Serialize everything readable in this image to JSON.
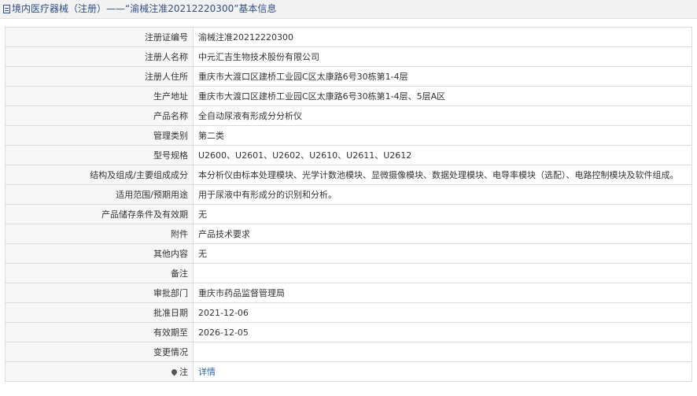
{
  "header": {
    "category": "境内医疗器械（注册）",
    "separator": "——",
    "title": "“渝械注准20212220300”基本信息"
  },
  "rows": [
    {
      "label": "注册证编号",
      "value": "渝械注准20212220300"
    },
    {
      "label": "注册人名称",
      "value": "中元汇吉生物技术股份有限公司"
    },
    {
      "label": "注册人住所",
      "value": "重庆市大渡口区建桥工业园C区太康路6号30栋第1-4层"
    },
    {
      "label": "生产地址",
      "value": "重庆市大渡口区建桥工业园C区太康路6号30栋第1-4层、5层A区"
    },
    {
      "label": "产品名称",
      "value": "全自动尿液有形成分分析仪"
    },
    {
      "label": "管理类别",
      "value": "第二类"
    },
    {
      "label": "型号规格",
      "value": "U2600、U2601、U2602、U2610、U2611、U2612"
    },
    {
      "label": "结构及组成/主要组成成分",
      "value": "本分析仪由标本处理模块、光学计数池模块、显微摄像模块、数据处理模块、电导率模块（选配）、电路控制模块及软件组成。"
    },
    {
      "label": "适用范围/预期用途",
      "value": "用于尿液中有形成分的识别和分析。"
    },
    {
      "label": "产品储存条件及有效期",
      "value": "无"
    },
    {
      "label": "附件",
      "value": "产品技术要求"
    },
    {
      "label": "其他内容",
      "value": "无"
    },
    {
      "label": "备注",
      "value": ""
    },
    {
      "label": "审批部门",
      "value": "重庆市药品监督管理局"
    },
    {
      "label": "批准日期",
      "value": "2021-12-06"
    },
    {
      "label": "有效期至",
      "value": "2026-12-05"
    },
    {
      "label": "变更情况",
      "value": ""
    }
  ],
  "footer_row": {
    "label": "注",
    "link": "详情"
  },
  "icons": {
    "title": "document-icon",
    "note": "pin-icon"
  },
  "colors": {
    "title_text": "#2f4f86",
    "link": "#2a64b6",
    "label_bg": "#f7f7f7",
    "border": "#dcdcdc"
  }
}
